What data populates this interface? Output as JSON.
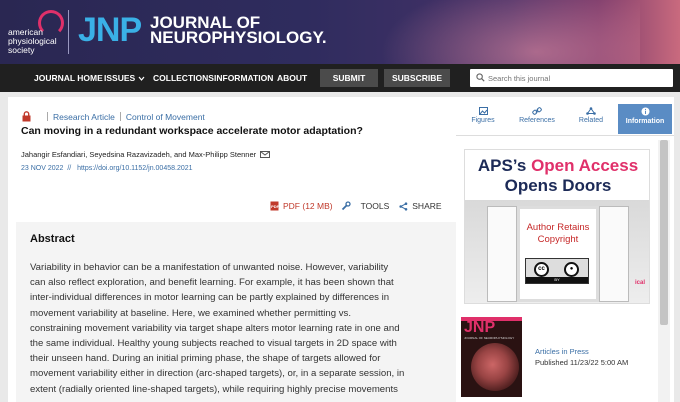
{
  "header": {
    "society_logo_text": [
      "american",
      "physiological",
      "society"
    ],
    "journal_mark": "JNP",
    "journal_name_line1": "JOURNAL OF",
    "journal_name_line2": "NEUROPHYSIOLOGY."
  },
  "nav": {
    "items": [
      "JOURNAL HOME",
      "ISSUES",
      "COLLECTIONS",
      "INFORMATION",
      "ABOUT"
    ],
    "submit": "SUBMIT",
    "subscribe": "SUBSCRIBE",
    "search_placeholder": "Search this journal"
  },
  "article": {
    "type": "Research Article",
    "category": "Control of Movement",
    "title": "Can moving in a redundant workspace accelerate motor adaptation?",
    "authors": "Jahangir Esfandiari, Seyedsina Razavizadeh, and Max-Philipp Stenner",
    "date": "23 NOV 2022",
    "doi": "https://doi.org/10.1152/jn.00458.2021",
    "pdf_label": "PDF (12 MB)",
    "tools_label": "TOOLS",
    "share_label": "SHARE"
  },
  "abstract": {
    "heading": "Abstract",
    "lines": [
      "Variability in behavior can be a manifestation of unwanted noise. However, variability",
      "can also reflect exploration, and benefit learning. For example, it has been shown that",
      "inter-individual differences in motor learning can be partly explained by differences in",
      "movement variability at baseline. Here, we examined whether permitting vs.",
      "constraining movement variability via target shape alters motor learning rate in one and",
      "the same individual. Healthy young subjects reached to visual targets in 2D space with",
      "their unseen hand. During an initial priming phase, the shape of targets allowed for",
      "movement variability either in direction (arc-shaped targets), or, in a separate session, in",
      "extent (radially oriented line-shaped targets), while requiring highly precise movements"
    ]
  },
  "sidebar": {
    "tabs": [
      "Figures",
      "References",
      "Related",
      "Information"
    ],
    "active_tab": "Information",
    "ad": {
      "line1_prefix": "APS’s",
      "line1_highlight": "Open Access",
      "line2": "Opens Doors",
      "door_text_1": "Author Retains",
      "door_text_2": "Copyright",
      "cc_label": "BY",
      "corner_text": "ical"
    },
    "cover": {
      "mark": "JNP",
      "subtitle": "JOURNAL OF NEUROPHYSIOLOGY"
    },
    "articles_in_press": "Articles in Press",
    "published": "Published 11/23/22 5:00 AM"
  },
  "colors": {
    "accent_blue": "#3a6ea5",
    "brand_pink": "#e0306a",
    "jnp_blue": "#3ab0e6",
    "navbar": "#202020",
    "active_tab": "#5a8cc4"
  }
}
